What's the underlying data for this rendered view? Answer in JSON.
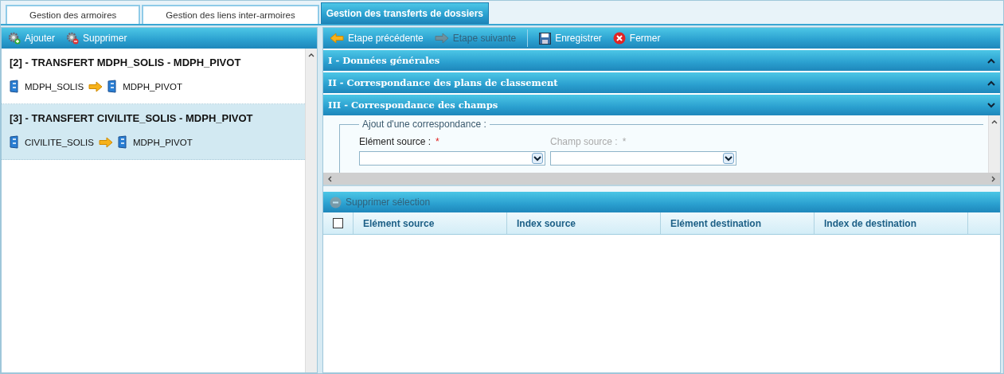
{
  "tabs": [
    {
      "label": "Gestion des armoires",
      "selected": false
    },
    {
      "label": "Gestion des liens inter-armoires",
      "selected": false
    },
    {
      "label": "Gestion des transferts de dossiers",
      "selected": true
    }
  ],
  "left_toolbar": [
    {
      "label": "Ajouter",
      "kind": "add"
    },
    {
      "label": "Supprimer",
      "kind": "remove"
    }
  ],
  "transfers": [
    {
      "title": "[2] - TRANSFERT MDPH_SOLIS - MDPH_PIVOT",
      "source": "MDPH_SOLIS",
      "target": "MDPH_PIVOT",
      "selected": false
    },
    {
      "title": "[3] - TRANSFERT CIVILITE_SOLIS - MDPH_PIVOT",
      "source": "CIVILITE_SOLIS",
      "target": "MDPH_PIVOT",
      "selected": true
    }
  ],
  "right_toolbar": [
    {
      "label": "Etape précédente",
      "kind": "back",
      "disabled": false
    },
    {
      "label": "Etape suivante",
      "kind": "next",
      "disabled": true
    },
    {
      "label": "Enregistrer",
      "kind": "save",
      "disabled": false
    },
    {
      "label": "Fermer",
      "kind": "close",
      "disabled": false
    }
  ],
  "sections": [
    {
      "title": "I - Données générales",
      "expanded": false
    },
    {
      "title": "II - Correspondance des plans de classement",
      "expanded": false
    },
    {
      "title": "III - Correspondance des champs",
      "expanded": true
    }
  ],
  "form": {
    "legend": "Ajout d'une correspondance :",
    "fields": [
      {
        "label": "Elément source :",
        "required_mark": "*",
        "disabled": false
      },
      {
        "label": "Champ source :",
        "required_mark": "*",
        "disabled": true
      }
    ]
  },
  "grid": {
    "delete_button": {
      "label": "Supprimer sélection",
      "disabled": true
    },
    "select_all": {
      "checked": false
    },
    "columns": [
      "Elément source",
      "Index source",
      "Elément destination",
      "Index de destination"
    ]
  }
}
